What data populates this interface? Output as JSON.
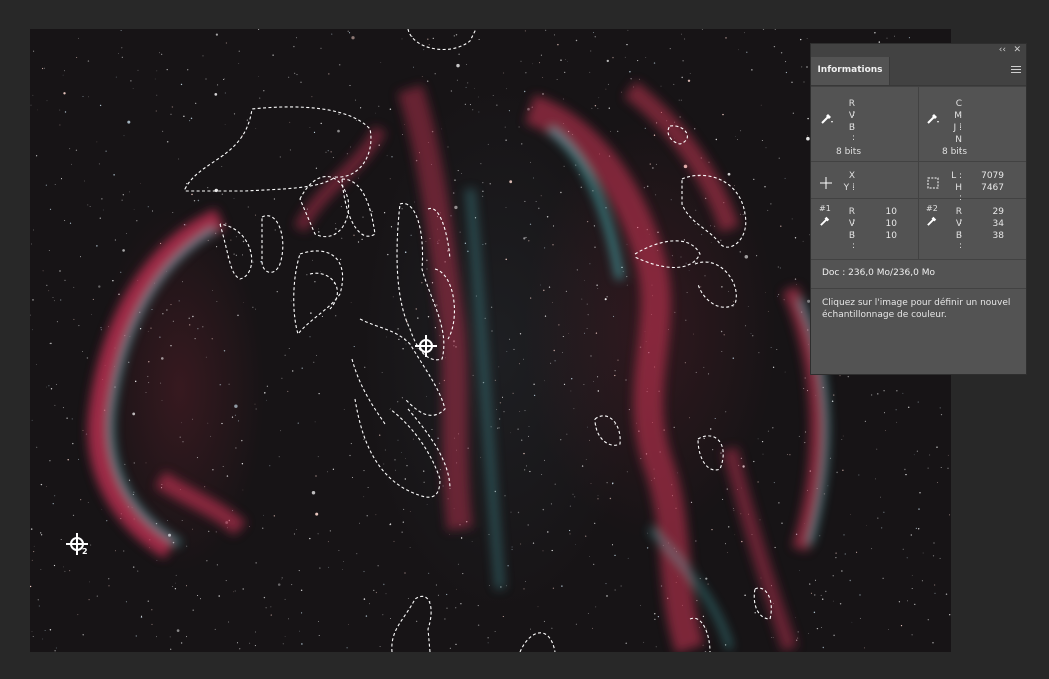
{
  "panel": {
    "collapse_label": "‹‹",
    "close_label": "✕",
    "tab_label": "Informations",
    "menu_icon": "panel-menu-icon",
    "rgb_block": {
      "labels": [
        "R :",
        "V :",
        "B :"
      ],
      "bits": "8 bits"
    },
    "cmyk_block": {
      "labels": [
        "C :",
        "M :",
        "J :",
        "N :"
      ],
      "bits": "8 bits"
    },
    "xy_block": {
      "labels": [
        "X :",
        "Y :"
      ]
    },
    "size_block": {
      "labels": [
        "L :",
        "H :"
      ],
      "values": [
        "7079",
        "7467"
      ]
    },
    "sampler1": {
      "tag": "#1",
      "labels": [
        "R :",
        "V :",
        "B :"
      ],
      "values": [
        "10",
        "10",
        "10"
      ]
    },
    "sampler2": {
      "tag": "#2",
      "labels": [
        "R :",
        "V :",
        "B :"
      ],
      "values": [
        "29",
        "34",
        "38"
      ]
    },
    "doc": "Doc : 236,0 Mo/236,0 Mo",
    "hint": "Cliquez sur l'image pour définir un nouvel échantillonnage de couleur."
  },
  "canvas": {
    "sampler_markers": [
      "1",
      "2"
    ],
    "colors": {
      "nebula_red": "#d8395a",
      "nebula_cyan": "#4fd1d6",
      "background": "#171416"
    }
  }
}
